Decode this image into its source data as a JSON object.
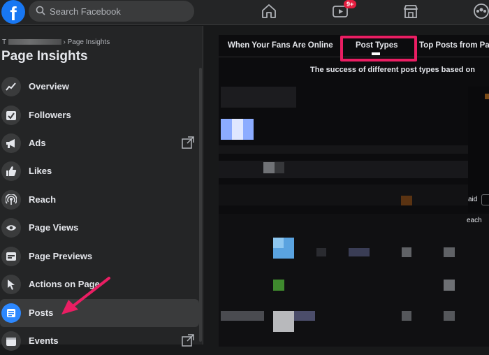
{
  "topbar": {
    "logo": "f",
    "search_placeholder": "Search Facebook",
    "watch_badge": "9+"
  },
  "sidebar": {
    "breadcrumb_prefix": "T",
    "breadcrumb_current": "› Page Insights",
    "title": "Page Insights",
    "items": [
      {
        "label": "Overview",
        "icon": "trend-line-icon"
      },
      {
        "label": "Followers",
        "icon": "checkmark-box-icon"
      },
      {
        "label": "Ads",
        "icon": "megaphone-icon"
      },
      {
        "label": "Likes",
        "icon": "thumbs-up-icon"
      },
      {
        "label": "Reach",
        "icon": "broadcast-icon"
      },
      {
        "label": "Page Views",
        "icon": "eye-icon"
      },
      {
        "label": "Page Previews",
        "icon": "window-icon"
      },
      {
        "label": "Actions on Page",
        "icon": "cursor-icon"
      },
      {
        "label": "Posts",
        "icon": "document-icon",
        "active": true
      },
      {
        "label": "Events",
        "icon": "calendar-icon"
      }
    ]
  },
  "insights": {
    "tabs": [
      "When Your Fans Are Online",
      "Post Types",
      "Top Posts from Pa"
    ],
    "active_tab": "Post Types",
    "subtitle": "The success of different post types based on",
    "paid_label": "aid",
    "reach_label": "each"
  },
  "colors": {
    "accent": "#1877f2",
    "highlight": "#ea1e63",
    "active_icon": "#2d88ff"
  }
}
